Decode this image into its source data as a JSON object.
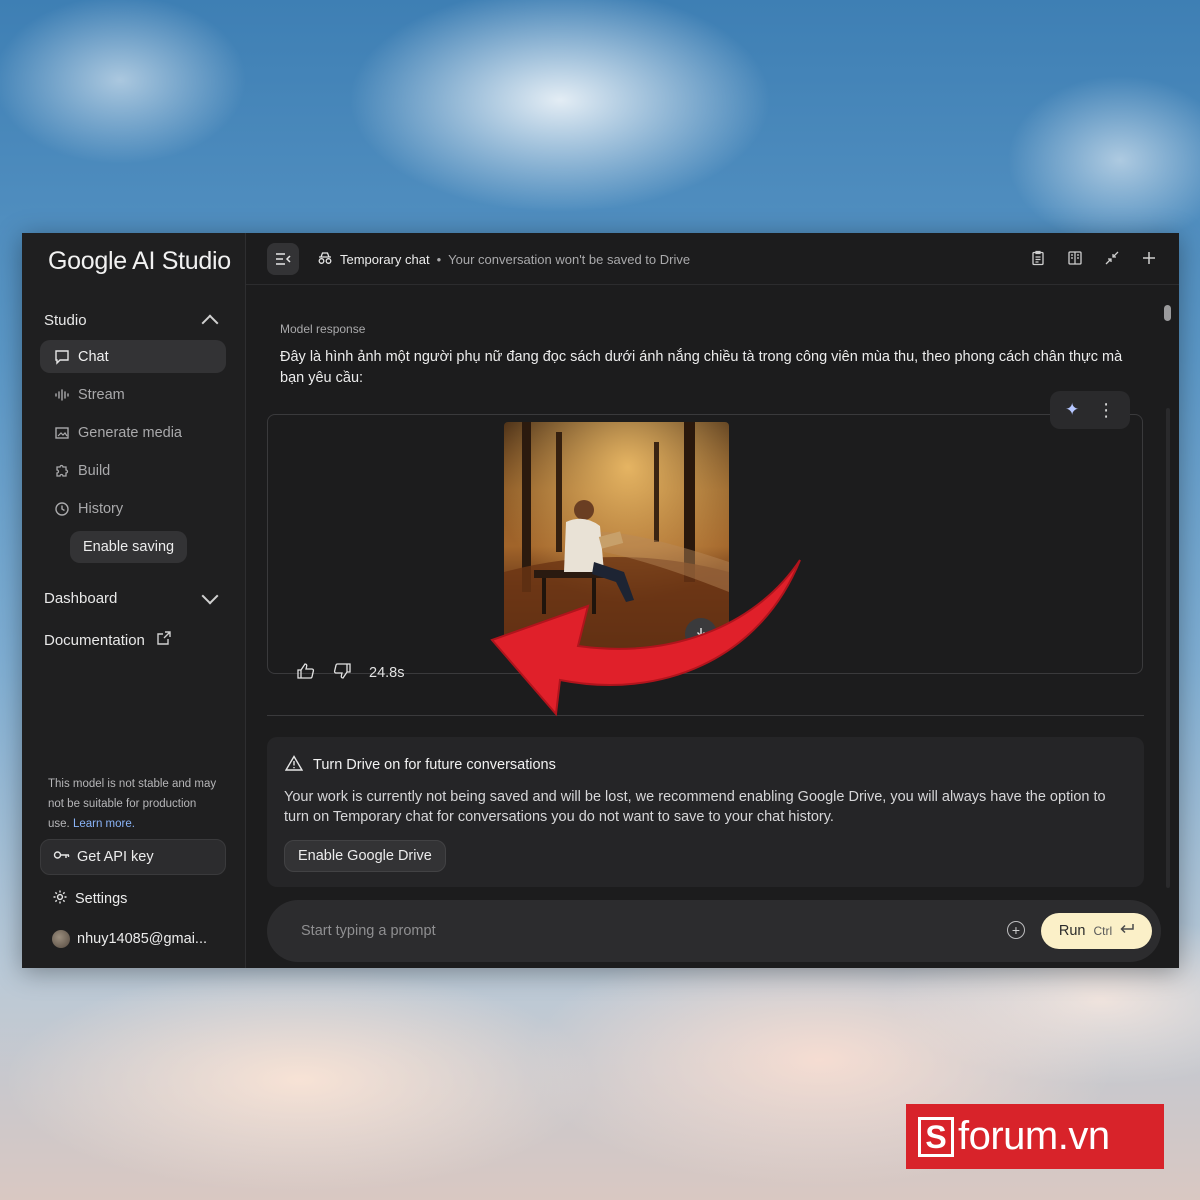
{
  "app": {
    "logo": "Google AI Studio"
  },
  "sidebar": {
    "studio_label": "Studio",
    "items": [
      {
        "label": "Chat",
        "icon": "chat-icon",
        "active": true
      },
      {
        "label": "Stream",
        "icon": "waveform-icon",
        "active": false
      },
      {
        "label": "Generate media",
        "icon": "image-icon",
        "active": false
      },
      {
        "label": "Build",
        "icon": "puzzle-icon",
        "active": false
      },
      {
        "label": "History",
        "icon": "history-icon",
        "active": false
      }
    ],
    "enable_saving": "Enable saving",
    "dashboard_label": "Dashboard",
    "documentation_label": "Documentation",
    "disclaimer_text": "This model is not stable and may not be suitable for production use. ",
    "disclaimer_link": "Learn more.",
    "get_api_key": "Get API key",
    "settings": "Settings",
    "account": "nhuy14085@gmai..."
  },
  "topbar": {
    "title": "Temporary chat",
    "subtitle": "Your conversation won't be saved to Drive"
  },
  "response": {
    "label": "Model response",
    "text": "Đây là hình ảnh một người phụ nữ đang đọc sách dưới ánh nắng chiều tà trong công viên mùa thu, theo phong cách chân thực mà bạn yêu cầu:",
    "time": "24.8s"
  },
  "drive_notice": {
    "title": "Turn Drive on for future conversations",
    "body": "Your work is currently not being saved and will be lost, we recommend enabling Google Drive, you will always have the option to turn on Temporary chat for conversations you do not want to save to your chat history.",
    "button": "Enable Google Drive"
  },
  "prompt": {
    "placeholder": "Start typing a prompt",
    "run_label": "Run",
    "run_hint": "Ctrl"
  },
  "watermark": {
    "brand_letter": "S",
    "brand_text": "forum.vn"
  },
  "colors": {
    "accent_run": "#fbf0c8",
    "link": "#8ab4f8",
    "arrow": "#e0202a",
    "brand": "#d8232a"
  }
}
